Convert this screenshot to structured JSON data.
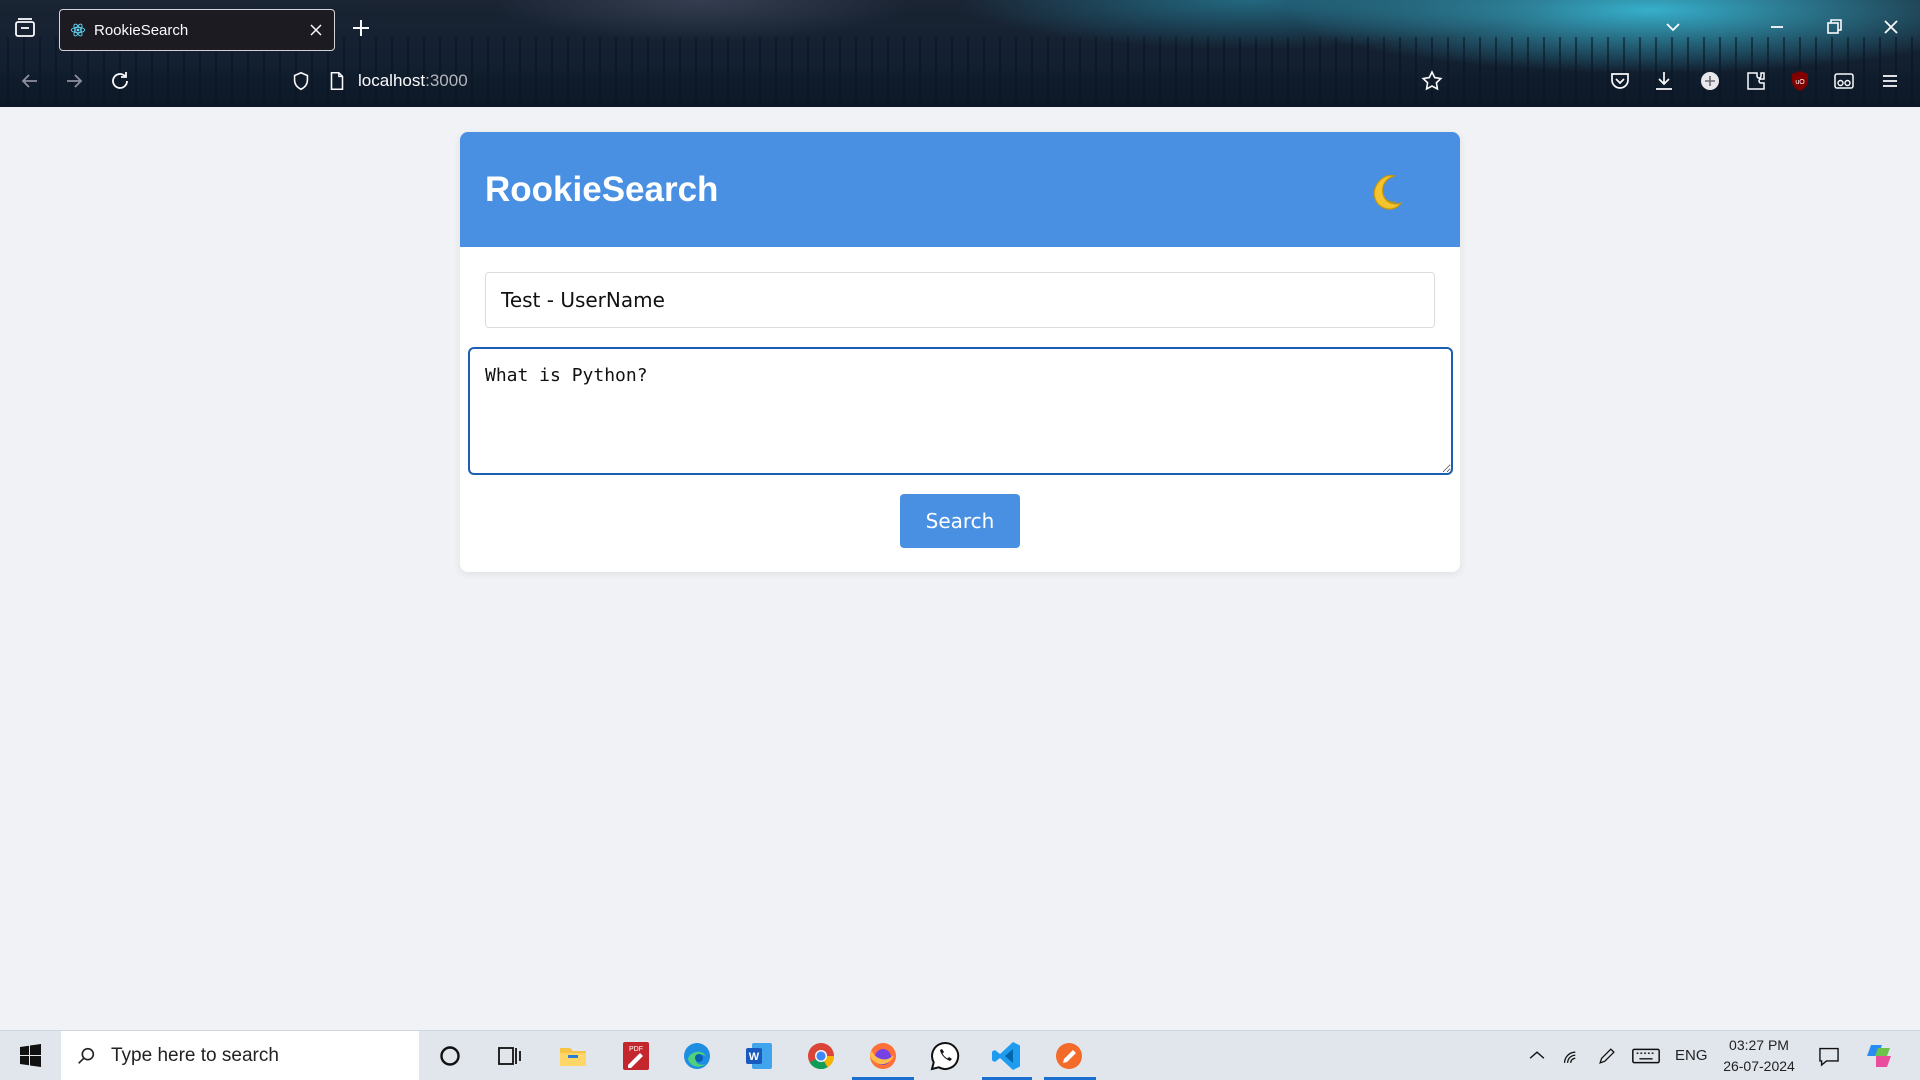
{
  "browser": {
    "tab_title": "RookieSearch",
    "url_host": "localhost",
    "url_port": ":3000"
  },
  "app": {
    "title": "RookieSearch",
    "theme_icon": "moon-icon",
    "name_value": "Test - UserName",
    "query_value": "What is Python?",
    "search_label": "Search",
    "colors": {
      "header": "#4a90e2",
      "button": "#4a90e2",
      "focus_border": "#1a5fb4",
      "background": "#f0f2f5"
    }
  },
  "taskbar": {
    "search_placeholder": "Type here to search",
    "language": "ENG",
    "time": "03:27 PM",
    "date": "26-07-2024",
    "apps": [
      "cortana-icon",
      "task-view-icon",
      "file-explorer-icon",
      "pdf-editor-icon",
      "edge-icon",
      "word-icon",
      "chrome-icon",
      "firefox-icon",
      "whatsapp-icon",
      "vscode-icon",
      "drawing-app-icon"
    ]
  }
}
